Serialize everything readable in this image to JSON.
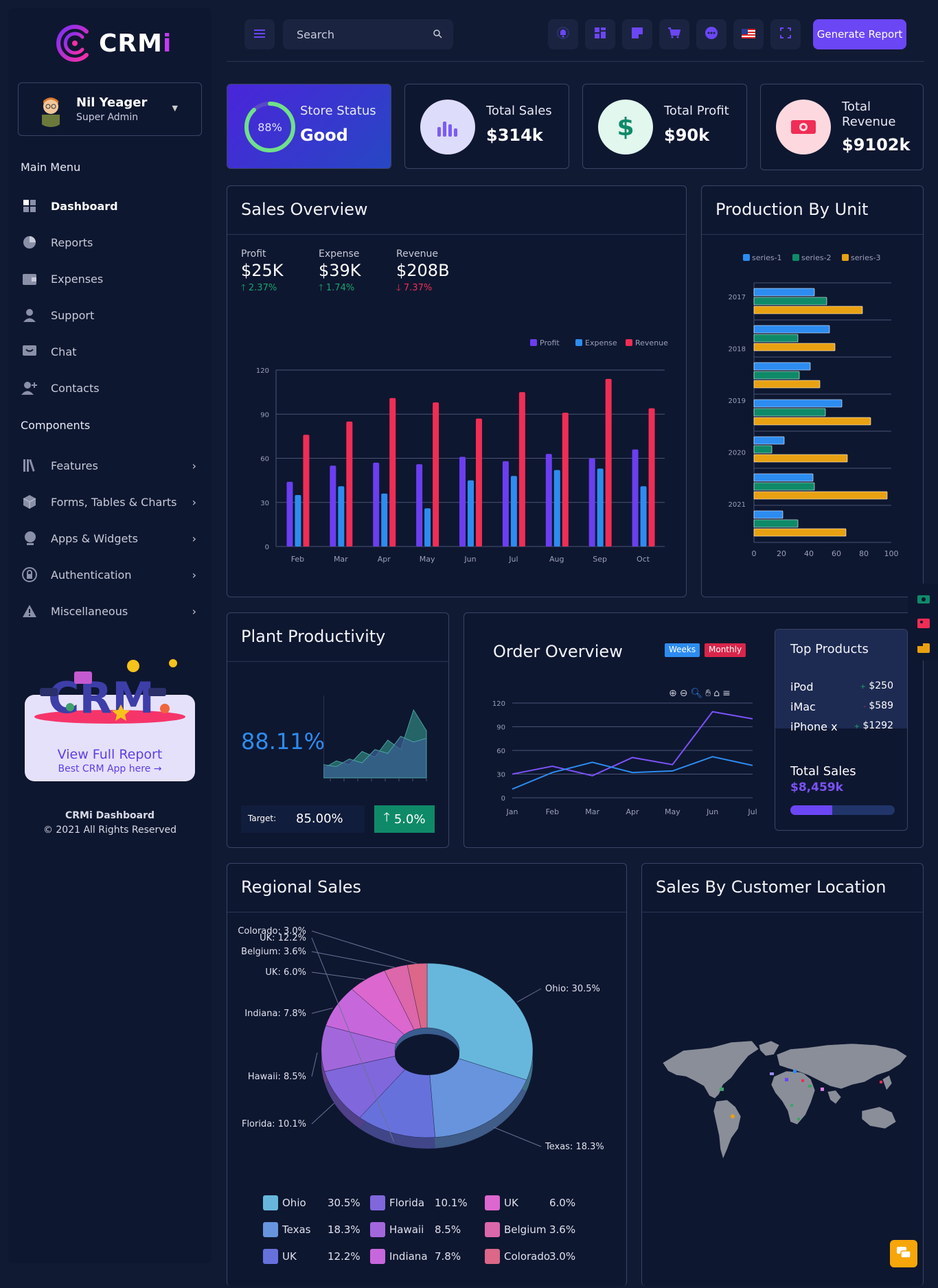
{
  "brand": {
    "name_a": "CRM",
    "name_b": "i"
  },
  "user": {
    "name": "Nil Yeager",
    "role": "Super Admin"
  },
  "sidebar": {
    "main_menu_label": "Main Menu",
    "main_items": [
      {
        "label": "Dashboard",
        "icon": "grid-icon"
      },
      {
        "label": "Reports",
        "icon": "pie-icon"
      },
      {
        "label": "Expenses",
        "icon": "wallet-icon"
      },
      {
        "label": "Support",
        "icon": "user-icon"
      },
      {
        "label": "Chat",
        "icon": "chat-icon"
      },
      {
        "label": "Contacts",
        "icon": "add-user-icon"
      }
    ],
    "components_label": "Components",
    "component_items": [
      {
        "label": "Features",
        "icon": "books-icon"
      },
      {
        "label": "Forms, Tables & Charts",
        "icon": "box-icon"
      },
      {
        "label": "Apps & Widgets",
        "icon": "globe-icon"
      },
      {
        "label": "Authentication",
        "icon": "lock-icon"
      },
      {
        "label": "Miscellaneous",
        "icon": "warning-icon"
      }
    ],
    "promo": {
      "title": "View Full Report",
      "link": "Best CRM App here →"
    },
    "footer_title": "CRMi Dashboard",
    "footer_copy": "© 2021 All Rights Reserved"
  },
  "topbar": {
    "search_placeholder": "Search",
    "generate_button": "Generate Report"
  },
  "stats": [
    {
      "label": "Store Status",
      "value": "Good",
      "circle": "88%"
    },
    {
      "label": "Total Sales",
      "value": "$314k"
    },
    {
      "label": "Total Profit",
      "value": "$90k"
    },
    {
      "label": "Total\nRevenue",
      "value": "$9102k"
    }
  ],
  "sales_overview": {
    "title": "Sales Overview",
    "kpis": [
      {
        "label": "Profit",
        "value": "$25K",
        "change": "2.37%",
        "dir": "up"
      },
      {
        "label": "Expense",
        "value": "$39K",
        "change": "1.74%",
        "dir": "up"
      },
      {
        "label": "Revenue",
        "value": "$208B",
        "change": "7.37%",
        "dir": "down"
      }
    ]
  },
  "production": {
    "title": "Production By Unit"
  },
  "plant": {
    "title": "Plant Productivity",
    "value": "88.11%",
    "target_label": "Target:",
    "target_value": "85.00%",
    "change": "5.0%"
  },
  "order_overview": {
    "title": "Order Overview",
    "weeks": "Weeks",
    "monthly": "Monthly"
  },
  "top_products": {
    "title": "Top Products",
    "items": [
      {
        "name": "iPod",
        "sign": "+",
        "price": "$250"
      },
      {
        "name": "iMac",
        "sign": "-",
        "price": "$589"
      },
      {
        "name": "iPhone x",
        "sign": "+",
        "price": "$1292"
      }
    ],
    "total_label": "Total Sales",
    "total_value": "$8,459k",
    "progress": 0.4
  },
  "regional": {
    "title": "Regional Sales"
  },
  "location": {
    "title": "Sales By Customer Location"
  },
  "colors": {
    "accent": "#6b46f5",
    "profit": "#6b3ef0",
    "expense": "#2d8cf0",
    "revenue": "#f02d55",
    "s1": "#2d8cf0",
    "s2": "#0f8a68",
    "s3": "#e8a112"
  },
  "chart_data": [
    {
      "type": "bar",
      "categories": [
        "Feb",
        "Mar",
        "Apr",
        "May",
        "Jun",
        "Jul",
        "Aug",
        "Sep",
        "Oct"
      ],
      "series": [
        {
          "name": "Profit",
          "values": [
            44,
            55,
            57,
            56,
            61,
            58,
            63,
            60,
            66
          ]
        },
        {
          "name": "Expense",
          "values": [
            35,
            41,
            36,
            26,
            45,
            48,
            52,
            53,
            41
          ]
        },
        {
          "name": "Revenue",
          "values": [
            76,
            85,
            101,
            98,
            87,
            105,
            91,
            114,
            94
          ]
        }
      ],
      "ylim": [
        0,
        120
      ],
      "yticks": [
        0,
        30,
        60,
        90,
        120
      ],
      "legend": "top-right"
    },
    {
      "type": "bar",
      "orientation": "horizontal",
      "categories": [
        "2017",
        "2018",
        "2019",
        "2020",
        "2021"
      ],
      "series": [
        {
          "name": "series-1",
          "values": [
            44,
            55,
            41,
            64,
            22,
            43,
            21
          ]
        },
        {
          "name": "series-2",
          "values": [
            53,
            32,
            33,
            52,
            13,
            44,
            32
          ]
        },
        {
          "name": "series-3",
          "values": [
            79,
            59,
            48,
            85,
            68,
            97,
            67
          ]
        }
      ],
      "xlim": [
        0,
        100
      ],
      "xticks": [
        0,
        20,
        40,
        60,
        80,
        100
      ],
      "legend": "top"
    },
    {
      "type": "area",
      "series": [
        {
          "name": "a",
          "values": [
            10,
            18,
            14,
            28,
            22,
            40,
            30,
            72,
            50
          ]
        },
        {
          "name": "b",
          "values": [
            14,
            12,
            20,
            16,
            30,
            26,
            44,
            38,
            42
          ]
        }
      ]
    },
    {
      "type": "line",
      "categories": [
        "Jan",
        "Feb",
        "Mar",
        "Apr",
        "May",
        "Jun",
        "Jul"
      ],
      "series": [
        {
          "name": "purple",
          "values": [
            30,
            40,
            28,
            51,
            42,
            109,
            100
          ]
        },
        {
          "name": "blue",
          "values": [
            11,
            32,
            45,
            32,
            34,
            52,
            41
          ]
        }
      ],
      "ylim": [
        0,
        120
      ],
      "yticks": [
        0,
        30,
        60,
        90,
        120
      ]
    },
    {
      "type": "pie",
      "style": "donut-3d",
      "slices": [
        {
          "label": "Ohio",
          "value": 30.5,
          "color": "#67b7dc"
        },
        {
          "label": "Texas",
          "value": 18.3,
          "color": "#6794dc"
        },
        {
          "label": "UK",
          "value": 12.2,
          "color": "#6771dc"
        },
        {
          "label": "Florida",
          "value": 10.1,
          "color": "#8067dc"
        },
        {
          "label": "Hawaii",
          "value": 8.5,
          "color": "#a367dc"
        },
        {
          "label": "Indiana",
          "value": 7.8,
          "color": "#c767dc"
        },
        {
          "label": "UK",
          "value": 6.0,
          "color": "#dc67ce"
        },
        {
          "label": "Belgium",
          "value": 3.6,
          "color": "#dc67ab"
        },
        {
          "label": "Colorado",
          "value": 3.0,
          "color": "#dc6788"
        }
      ]
    }
  ]
}
